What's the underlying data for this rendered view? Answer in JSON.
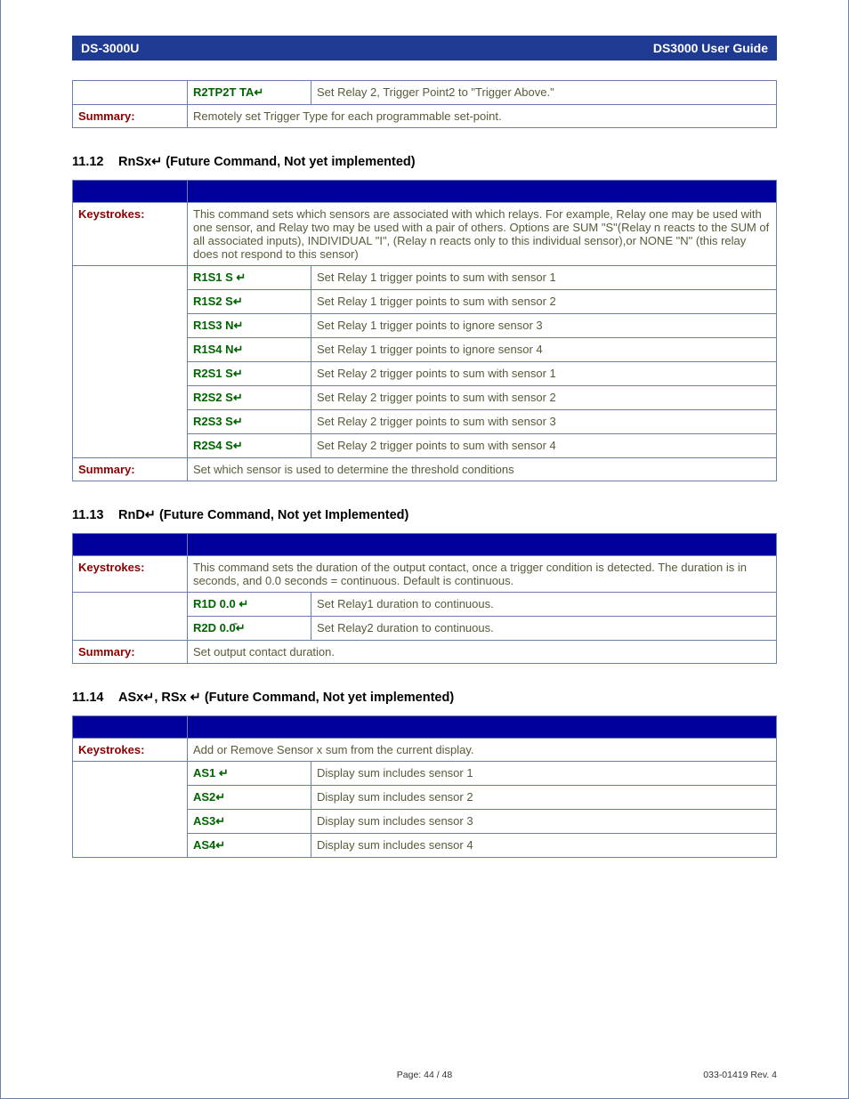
{
  "header": {
    "left": "DS-3000U",
    "right": "DS3000 User Guide"
  },
  "enterGlyph": "↵",
  "topTable": {
    "code": "R2TP2T TA",
    "desc": "Set Relay 2, Trigger Point2 to \"Trigger Above.\"",
    "summaryLabel": "Summary:",
    "summaryText": "Remotely set Trigger Type for each programmable set-point."
  },
  "sections": [
    {
      "num": "11.12",
      "title": "RnSx↵  (Future Command, Not yet implemented)",
      "keystrokesLabel": "Keystrokes:",
      "intro": "This command sets which sensors are associated with which relays.  For example, Relay one may be used with one sensor, and Relay two may be used with a pair of others.  Options are SUM \"S\"(Relay n reacts to the SUM of all associated inputs), INDIVIDUAL \"I\", (Relay n reacts only to this individual sensor),or NONE  \"N\" (this relay does not respond to this sensor)",
      "rows": [
        {
          "code": "R1S1 S ",
          "desc": "Set Relay 1 trigger points to sum with sensor 1"
        },
        {
          "code": "R1S2 S",
          "desc": "Set Relay 1 trigger points to sum with sensor 2"
        },
        {
          "code": "R1S3 N",
          "desc": "Set Relay 1 trigger points to ignore sensor 3"
        },
        {
          "code": "R1S4 N",
          "desc": "Set Relay 1 trigger points to ignore sensor 4"
        },
        {
          "code": "R2S1 S",
          "desc": "Set Relay 2 trigger points to sum with sensor 1"
        },
        {
          "code": "R2S2 S",
          "desc": "Set Relay 2 trigger points to sum with sensor 2"
        },
        {
          "code": "R2S3 S",
          "desc": "Set Relay 2 trigger points to sum with sensor 3"
        },
        {
          "code": "R2S4 S",
          "desc": "Set Relay 2 trigger points to sum with sensor 4"
        }
      ],
      "summaryLabel": "Summary:",
      "summaryText": "Set which sensor is used to determine the threshold conditions"
    },
    {
      "num": "11.13",
      "title": "RnD↵ (Future Command, Not yet Implemented)",
      "keystrokesLabel": "Keystrokes:",
      "intro": "This command sets the duration of the output contact, once a trigger condition is detected.  The duration is in seconds, and 0.0 seconds = continuous.  Default is continuous.",
      "rows": [
        {
          "code": "R1D 0.0 ",
          "desc": "Set Relay1 duration to continuous."
        },
        {
          "code": "R2D 0.0̄",
          "desc": "Set Relay2 duration to continuous."
        }
      ],
      "summaryLabel": "Summary:",
      "summaryText": "Set output contact duration."
    },
    {
      "num": "11.14",
      "title": "ASx↵, RSx ↵ (Future Command, Not yet implemented)",
      "keystrokesLabel": "Keystrokes:",
      "intro": "Add or Remove Sensor x sum from the current display.",
      "rows": [
        {
          "code": "AS1 ",
          "desc": "Display sum includes sensor 1"
        },
        {
          "code": "AS2",
          "desc": "Display sum includes sensor 2"
        },
        {
          "code": "AS3",
          "desc": "Display sum includes sensor 3"
        },
        {
          "code": "AS4",
          "desc": "Display sum includes sensor 4"
        }
      ],
      "summaryLabel": "",
      "summaryText": ""
    }
  ],
  "footer": {
    "page": "Page: 44 / 48",
    "rev": "033-01419 Rev. 4"
  }
}
